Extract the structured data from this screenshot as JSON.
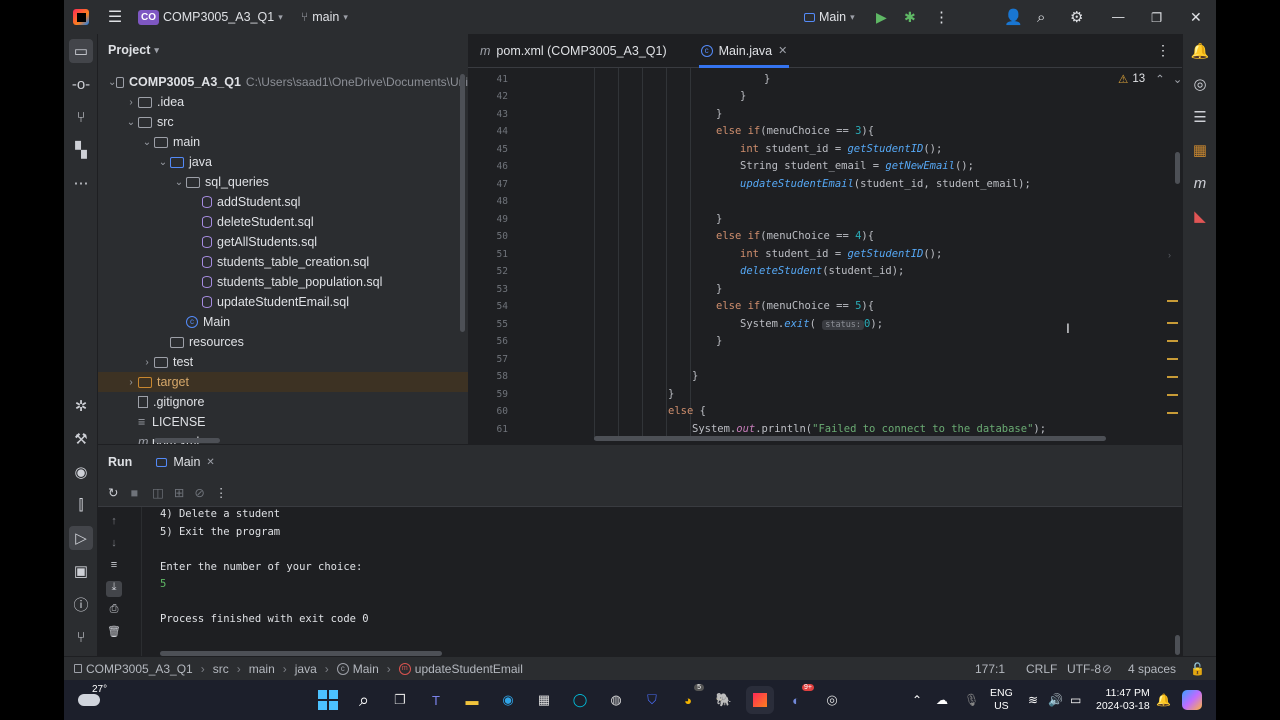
{
  "title_bar": {
    "project_badge": "CO",
    "project_name": "COMP3005_A3_Q1",
    "branch": "main",
    "run_config": "Main"
  },
  "project_panel": {
    "title": "Project",
    "root_name": "COMP3005_A3_Q1",
    "root_path": "C:\\Users\\saad1\\OneDrive\\Documents\\Uni",
    "items": [
      {
        "label": ".idea"
      },
      {
        "label": "src"
      },
      {
        "label": "main"
      },
      {
        "label": "java"
      },
      {
        "label": "sql_queries"
      },
      {
        "label": "addStudent.sql"
      },
      {
        "label": "deleteStudent.sql"
      },
      {
        "label": "getAllStudents.sql"
      },
      {
        "label": "students_table_creation.sql"
      },
      {
        "label": "students_table_population.sql"
      },
      {
        "label": "updateStudentEmail.sql"
      },
      {
        "label": "Main"
      },
      {
        "label": "resources"
      },
      {
        "label": "test"
      },
      {
        "label": "target"
      },
      {
        "label": ".gitignore"
      },
      {
        "label": "LICENSE"
      },
      {
        "label": "pom.xml"
      }
    ]
  },
  "editor": {
    "tabs": [
      {
        "label": "pom.xml (COMP3005_A3_Q1)"
      },
      {
        "label": "Main.java"
      }
    ],
    "problems_count": "13",
    "lines": [
      {
        "n": "41",
        "text": "}"
      },
      {
        "n": "42",
        "text": "}"
      },
      {
        "n": "43",
        "text": "}"
      },
      {
        "n": "44",
        "a": "else if",
        "b": "(menuChoice == ",
        "c": "3",
        "d": "){"
      },
      {
        "n": "45",
        "a": "int",
        "b": " student_id = ",
        "c": "getStudentID",
        "d": "();"
      },
      {
        "n": "46",
        "a": "String student_email = ",
        "b": "getNewEmail",
        "c": "();"
      },
      {
        "n": "47",
        "a": "updateStudentEmail",
        "b": "(student_id, student_email);"
      },
      {
        "n": "48",
        "text": ""
      },
      {
        "n": "49",
        "text": "}"
      },
      {
        "n": "50",
        "a": "else if",
        "b": "(menuChoice == ",
        "c": "4",
        "d": "){"
      },
      {
        "n": "51",
        "a": "int",
        "b": " student_id = ",
        "c": "getStudentID",
        "d": "();"
      },
      {
        "n": "52",
        "a": "deleteStudent",
        "b": "(student_id);"
      },
      {
        "n": "53",
        "text": "}"
      },
      {
        "n": "54",
        "a": "else if",
        "b": "(menuChoice == ",
        "c": "5",
        "d": "){"
      },
      {
        "n": "55",
        "a": "System.",
        "b": "exit",
        "c": "( ",
        "hint": "status:",
        "d": "0",
        "e": ");"
      },
      {
        "n": "56",
        "text": "}"
      },
      {
        "n": "57",
        "text": ""
      },
      {
        "n": "58",
        "text": "}"
      },
      {
        "n": "59",
        "text": "}"
      },
      {
        "n": "60",
        "a": "else",
        "b": " {"
      },
      {
        "n": "61",
        "a": "System.",
        "b": "out",
        "c": ".println(",
        "d": "\"Failed to connect to the database\"",
        "e": ");"
      }
    ]
  },
  "run_panel": {
    "title": "Run",
    "tab_label": "Main",
    "output": [
      "4) Delete a student",
      "5) Exit the program",
      "",
      "Enter the number of your choice:",
      "5",
      "",
      "Process finished with exit code 0"
    ]
  },
  "status_bar": {
    "breadcrumbs": [
      "COMP3005_A3_Q1",
      "src",
      "main",
      "java",
      "Main",
      "updateStudentEmail"
    ],
    "position": "177:1",
    "line_sep": "CRLF",
    "encoding": "UTF-8",
    "indent": "4 spaces"
  },
  "taskbar": {
    "weather": "27°",
    "lang_top": "ENG",
    "lang_bottom": "US",
    "time": "11:47 PM",
    "date": "2024-03-18",
    "badge_chrome": "5",
    "badge_discord": "9+"
  },
  "colors": {
    "accent": "#3574f0",
    "bg": "#1e1f22",
    "panel": "#2b2d30"
  }
}
